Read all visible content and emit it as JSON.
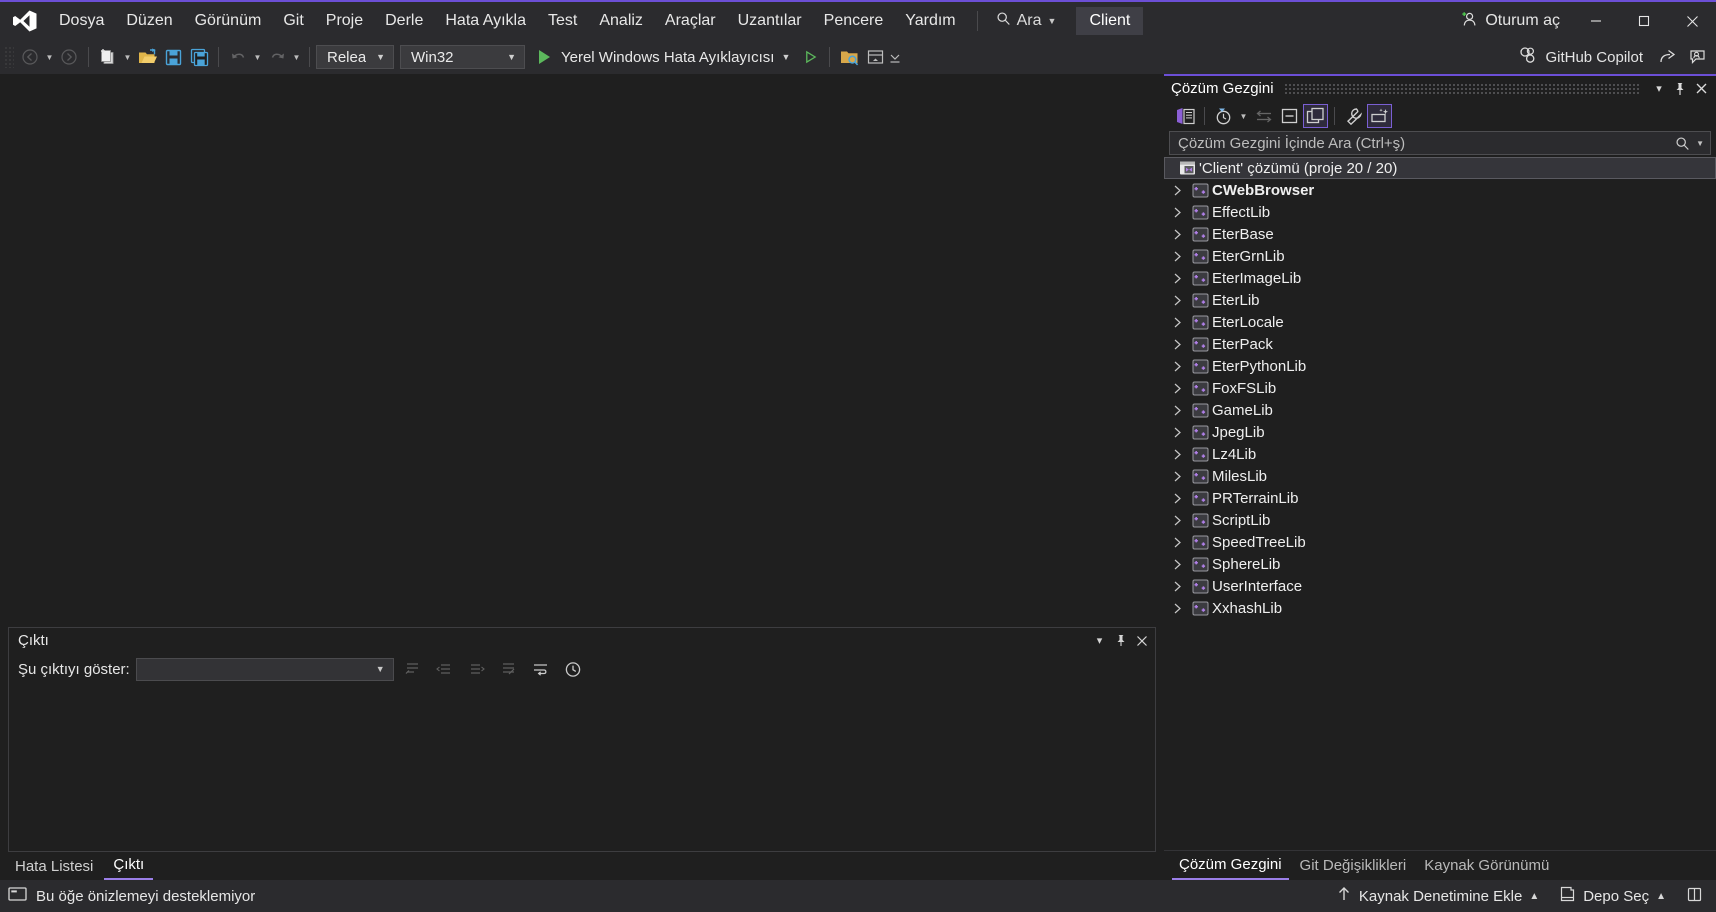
{
  "window": {
    "app_icon": "visual-studio-logo",
    "client_chip": "Client",
    "sign_in": "Oturum aç",
    "minimize": "─",
    "maximize": "□",
    "close": "✕"
  },
  "menu": {
    "items": [
      {
        "label": "Dosya",
        "accel": "D"
      },
      {
        "label": "Düzen",
        "accel": "z"
      },
      {
        "label": "Görünüm",
        "accel": "G"
      },
      {
        "label": "Git",
        "accel": "t"
      },
      {
        "label": "Proje",
        "accel": "P"
      },
      {
        "label": "Derle",
        "accel": "l"
      },
      {
        "label": "Hata Ayıkla",
        "accel": "H"
      },
      {
        "label": "Test",
        "accel": "s"
      },
      {
        "label": "Analiz",
        "accel": "z"
      },
      {
        "label": "Araçlar",
        "accel": "A"
      },
      {
        "label": "Uzantılar",
        "accel": "U"
      },
      {
        "label": "Pencere",
        "accel": "n"
      },
      {
        "label": "Yardım",
        "accel": "Y"
      }
    ],
    "search_label": "Ara"
  },
  "toolbar": {
    "nav_back": "back-arrow",
    "nav_forward": "forward-arrow",
    "new_item": "new-item",
    "open_file": "open-file",
    "save": "save",
    "save_all": "save-all",
    "undo": "undo",
    "redo": "redo",
    "configuration": "Release",
    "platform": "Win32",
    "run_label": "Yerel Windows Hata Ayıklayıcısı",
    "copilot_label": "GitHub Copilot"
  },
  "output": {
    "title": "Çıktı",
    "show_output_from_label": "Şu çıktıyı göster:",
    "selected_source": "",
    "tabs": [
      {
        "label": "Hata Listesi",
        "active": false
      },
      {
        "label": "Çıktı",
        "active": true
      }
    ]
  },
  "solution_explorer": {
    "title": "Çözüm Gezgini",
    "search_placeholder": "Çözüm Gezgini İçinde Ara (Ctrl+ş)",
    "search_value": "",
    "root": {
      "label": "'Client' çözümü (proje 20 / 20)",
      "icon": "solution-icon",
      "selected": true
    },
    "projects": [
      {
        "label": "CWebBrowser",
        "bold": true
      },
      {
        "label": "EffectLib",
        "bold": false
      },
      {
        "label": "EterBase",
        "bold": false
      },
      {
        "label": "EterGrnLib",
        "bold": false
      },
      {
        "label": "EterImageLib",
        "bold": false
      },
      {
        "label": "EterLib",
        "bold": false
      },
      {
        "label": "EterLocale",
        "bold": false
      },
      {
        "label": "EterPack",
        "bold": false
      },
      {
        "label": "EterPythonLib",
        "bold": false
      },
      {
        "label": "FoxFSLib",
        "bold": false
      },
      {
        "label": "GameLib",
        "bold": false
      },
      {
        "label": "JpegLib",
        "bold": false
      },
      {
        "label": "Lz4Lib",
        "bold": false
      },
      {
        "label": "MilesLib",
        "bold": false
      },
      {
        "label": "PRTerrainLib",
        "bold": false
      },
      {
        "label": "ScriptLib",
        "bold": false
      },
      {
        "label": "SpeedTreeLib",
        "bold": false
      },
      {
        "label": "SphereLib",
        "bold": false
      },
      {
        "label": "UserInterface",
        "bold": false
      },
      {
        "label": "XxhashLib",
        "bold": false
      }
    ],
    "tabs": [
      {
        "label": "Çözüm Gezgini",
        "active": true
      },
      {
        "label": "Git Değişiklikleri",
        "active": false
      },
      {
        "label": "Kaynak Görünümü",
        "active": false
      }
    ]
  },
  "status_bar": {
    "message": "Bu öğe önizlemeyi desteklemiyor",
    "add_to_source_control": "Kaynak Denetimine Ekle",
    "select_repository": "Depo Seç"
  },
  "colors": {
    "accent_purple": "#6c4fd6",
    "tab_underline": "#9b7fe8",
    "titlebar_bg": "#2b2b2e",
    "editor_bg": "#1f1f1f",
    "run_green": "#5cb85c",
    "project_icon": "#b07fe8"
  }
}
